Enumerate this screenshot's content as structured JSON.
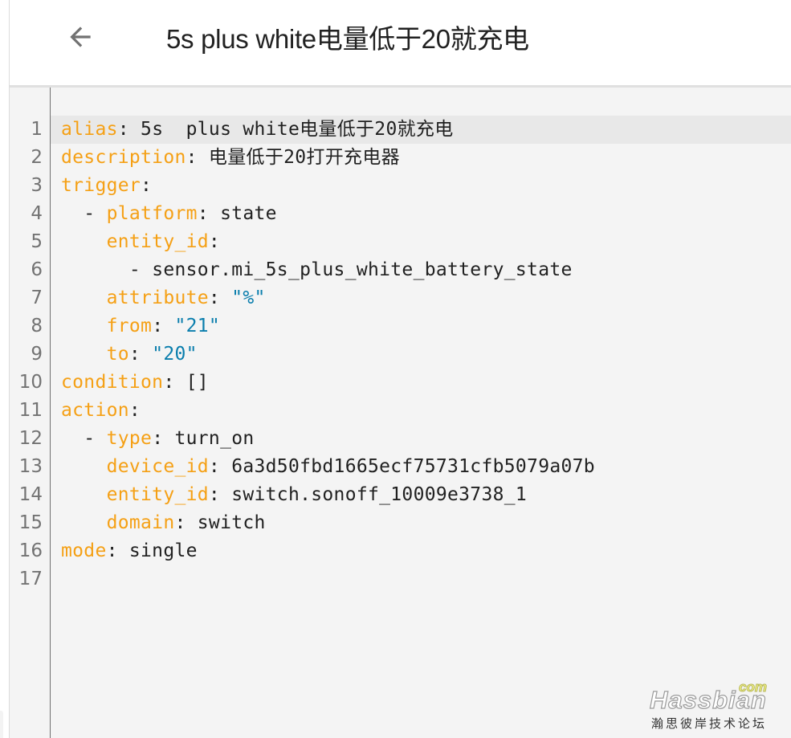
{
  "header": {
    "back_icon": "arrow-left-icon",
    "title": "5s plus white电量低于20就充电"
  },
  "editor": {
    "active_line": 1,
    "lines": [
      {
        "n": "1",
        "indent": "",
        "dash": "",
        "key": "alias",
        "sep": ": ",
        "value": "5s  plus white电量低于20就充电",
        "vtype": "plain"
      },
      {
        "n": "2",
        "indent": "",
        "dash": "",
        "key": "description",
        "sep": ": ",
        "value": "电量低于20打开充电器",
        "vtype": "plain"
      },
      {
        "n": "3",
        "indent": "",
        "dash": "",
        "key": "trigger",
        "sep": ":",
        "value": "",
        "vtype": "plain"
      },
      {
        "n": "4",
        "indent": "  ",
        "dash": "- ",
        "key": "platform",
        "sep": ": ",
        "value": "state",
        "vtype": "plain"
      },
      {
        "n": "5",
        "indent": "    ",
        "dash": "",
        "key": "entity_id",
        "sep": ":",
        "value": "",
        "vtype": "plain"
      },
      {
        "n": "6",
        "indent": "      ",
        "dash": "- ",
        "key": "",
        "sep": "",
        "value": "sensor.mi_5s_plus_white_battery_state",
        "vtype": "plain"
      },
      {
        "n": "7",
        "indent": "    ",
        "dash": "",
        "key": "attribute",
        "sep": ": ",
        "value": "\"%\"",
        "vtype": "string"
      },
      {
        "n": "8",
        "indent": "    ",
        "dash": "",
        "key": "from",
        "sep": ": ",
        "value": "\"21\"",
        "vtype": "string"
      },
      {
        "n": "9",
        "indent": "    ",
        "dash": "",
        "key": "to",
        "sep": ": ",
        "value": "\"20\"",
        "vtype": "string"
      },
      {
        "n": "10",
        "indent": "",
        "dash": "",
        "key": "condition",
        "sep": ": ",
        "value": "[]",
        "vtype": "plain"
      },
      {
        "n": "11",
        "indent": "",
        "dash": "",
        "key": "action",
        "sep": ":",
        "value": "",
        "vtype": "plain"
      },
      {
        "n": "12",
        "indent": "  ",
        "dash": "- ",
        "key": "type",
        "sep": ": ",
        "value": "turn_on",
        "vtype": "plain"
      },
      {
        "n": "13",
        "indent": "    ",
        "dash": "",
        "key": "device_id",
        "sep": ": ",
        "value": "6a3d50fbd1665ecf75731cfb5079a07b",
        "vtype": "plain"
      },
      {
        "n": "14",
        "indent": "    ",
        "dash": "",
        "key": "entity_id",
        "sep": ": ",
        "value": "switch.sonoff_10009e3738_1",
        "vtype": "plain"
      },
      {
        "n": "15",
        "indent": "    ",
        "dash": "",
        "key": "domain",
        "sep": ": ",
        "value": "switch",
        "vtype": "plain"
      },
      {
        "n": "16",
        "indent": "",
        "dash": "",
        "key": "mode",
        "sep": ": ",
        "value": "single",
        "vtype": "plain"
      },
      {
        "n": "17",
        "indent": "",
        "dash": "",
        "key": "",
        "sep": "",
        "value": "",
        "vtype": "plain"
      }
    ]
  },
  "colors": {
    "key": "#f5a015",
    "string": "#0a7ead",
    "text": "#212121",
    "line_number": "#737373",
    "editor_bg": "#f4f4f4",
    "active_line_bg": "#e8e8e8"
  },
  "watermark": {
    "brand": "Hassbian",
    "tld": "com",
    "subtitle": "瀚思彼岸技术论坛"
  }
}
